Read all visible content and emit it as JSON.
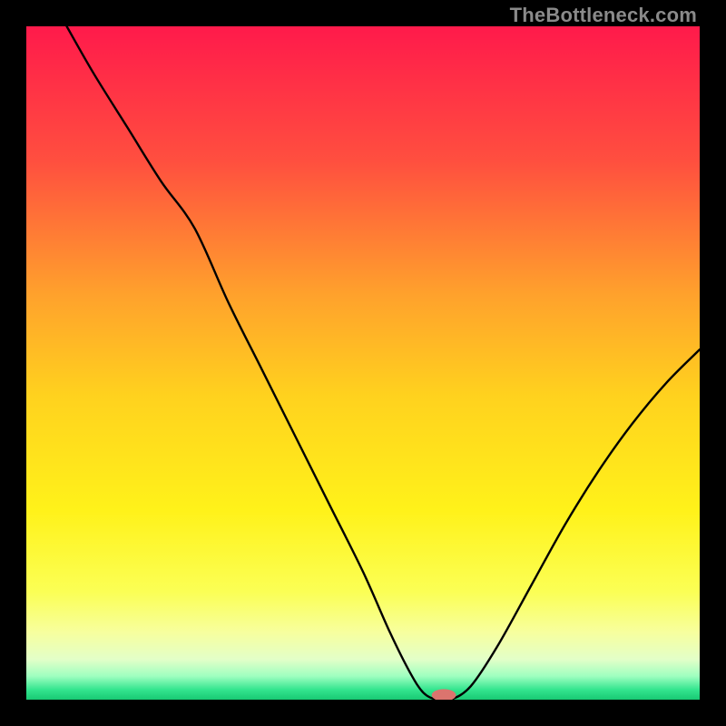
{
  "watermark": "TheBottleneck.com",
  "chart_data": {
    "type": "line",
    "title": "",
    "xlabel": "",
    "ylabel": "",
    "xlim": [
      0,
      100
    ],
    "ylim": [
      0,
      100
    ],
    "background": {
      "gradient_type": "vertical",
      "stops": [
        {
          "pos": 0.0,
          "color": "#ff1a4b"
        },
        {
          "pos": 0.2,
          "color": "#ff4f3f"
        },
        {
          "pos": 0.4,
          "color": "#ffa22c"
        },
        {
          "pos": 0.55,
          "color": "#ffd21e"
        },
        {
          "pos": 0.72,
          "color": "#fff21a"
        },
        {
          "pos": 0.84,
          "color": "#fbff55"
        },
        {
          "pos": 0.9,
          "color": "#f7ff9e"
        },
        {
          "pos": 0.94,
          "color": "#e3ffc8"
        },
        {
          "pos": 0.965,
          "color": "#9fffc0"
        },
        {
          "pos": 0.985,
          "color": "#34e58f"
        },
        {
          "pos": 1.0,
          "color": "#18c973"
        }
      ]
    },
    "series": [
      {
        "name": "bottleneck-curve",
        "color": "#000000",
        "x": [
          6,
          10,
          15,
          20,
          25,
          30,
          35,
          40,
          45,
          50,
          54,
          57,
          59,
          61,
          63,
          66,
          70,
          75,
          80,
          85,
          90,
          95,
          100
        ],
        "y": [
          100,
          93,
          85,
          77,
          70,
          59,
          49,
          39,
          29,
          19,
          10,
          4,
          1,
          0,
          0,
          2,
          8,
          17,
          26,
          34,
          41,
          47,
          52
        ]
      }
    ],
    "marker": {
      "name": "optimal-point",
      "color": "#db746e",
      "x": 62,
      "y": 0,
      "rx": 1.8,
      "ry": 0.9
    }
  }
}
